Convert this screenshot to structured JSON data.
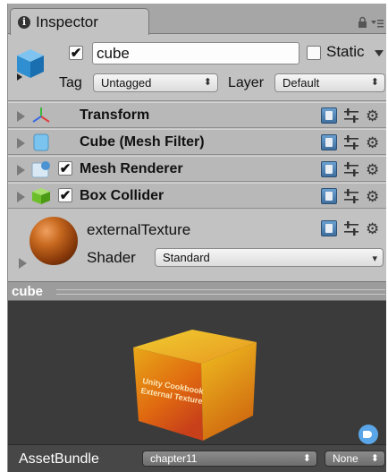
{
  "tab": {
    "title": "Inspector"
  },
  "object": {
    "active_checked": true,
    "name": "cube",
    "static_label": "Static",
    "static_checked": false,
    "tag_label": "Tag",
    "tag_value": "Untagged",
    "layer_label": "Layer",
    "layer_value": "Default"
  },
  "components": [
    {
      "name": "Transform",
      "has_checkbox": false,
      "icon": "transform-axes-icon"
    },
    {
      "name": "Cube (Mesh Filter)",
      "has_checkbox": false,
      "icon": "mesh-filter-icon"
    },
    {
      "name": "Mesh Renderer",
      "has_checkbox": true,
      "checked": true,
      "icon": "mesh-renderer-icon"
    },
    {
      "name": "Box Collider",
      "has_checkbox": true,
      "checked": true,
      "icon": "box-collider-icon"
    }
  ],
  "material": {
    "name": "externalTexture",
    "shader_label": "Shader",
    "shader_value": "Standard"
  },
  "preview": {
    "title": "cube",
    "cube_texture_text": "Unity Cookbook External Texture"
  },
  "asset_bundle": {
    "label": "AssetBundle",
    "bundle_value": "chapter11",
    "variant_value": "None"
  },
  "colors": {
    "panel": "#c2c2c2",
    "header": "#b8b8b8",
    "preview_bg": "#3b3b3b",
    "accent": "#5aa6e8"
  }
}
